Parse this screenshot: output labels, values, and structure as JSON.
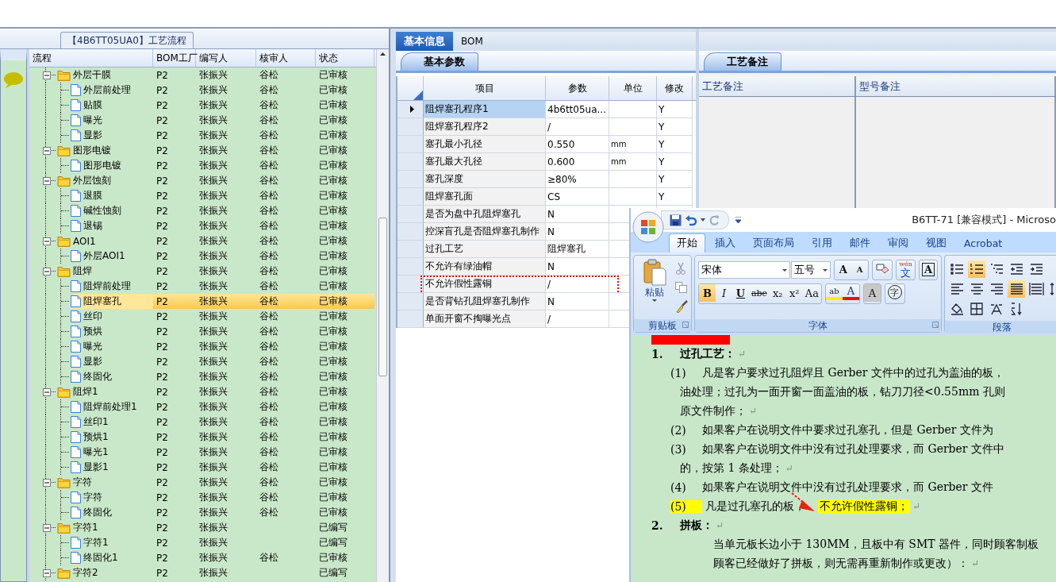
{
  "left_panel": {
    "title": "【4B6TT05UA0】工艺流程",
    "columns": [
      "流程",
      "BOM工厂",
      "编写人",
      "核审人",
      "状态"
    ],
    "tree": [
      {
        "name": "外层干膜",
        "bom": "P2",
        "writer": "张振兴",
        "reviewer": "谷松",
        "status": "已审核",
        "expanded": true,
        "selected": false,
        "children": [
          {
            "name": "外层前处理",
            "bom": "P2",
            "writer": "张振兴",
            "reviewer": "谷松",
            "status": "已审核",
            "selected": false
          },
          {
            "name": "贴膜",
            "bom": "P2",
            "writer": "张振兴",
            "reviewer": "谷松",
            "status": "已审核",
            "selected": false
          },
          {
            "name": "曝光",
            "bom": "P2",
            "writer": "张振兴",
            "reviewer": "谷松",
            "status": "已审核",
            "selected": false
          },
          {
            "name": "显影",
            "bom": "P2",
            "writer": "张振兴",
            "reviewer": "谷松",
            "status": "已审核",
            "selected": false
          }
        ]
      },
      {
        "name": "图形电镀",
        "bom": "P2",
        "writer": "张振兴",
        "reviewer": "谷松",
        "status": "已审核",
        "expanded": true,
        "selected": false,
        "children": [
          {
            "name": "图形电镀",
            "bom": "P2",
            "writer": "张振兴",
            "reviewer": "谷松",
            "status": "已审核",
            "selected": false
          }
        ]
      },
      {
        "name": "外层蚀刻",
        "bom": "P2",
        "writer": "张振兴",
        "reviewer": "谷松",
        "status": "已审核",
        "expanded": true,
        "selected": false,
        "children": [
          {
            "name": "退膜",
            "bom": "P2",
            "writer": "张振兴",
            "reviewer": "谷松",
            "status": "已审核",
            "selected": false
          },
          {
            "name": "碱性蚀刻",
            "bom": "P2",
            "writer": "张振兴",
            "reviewer": "谷松",
            "status": "已审核",
            "selected": false
          },
          {
            "name": "退锡",
            "bom": "P2",
            "writer": "张振兴",
            "reviewer": "谷松",
            "status": "已审核",
            "selected": false
          }
        ]
      },
      {
        "name": "AOI1",
        "bom": "P2",
        "writer": "张振兴",
        "reviewer": "谷松",
        "status": "已审核",
        "expanded": true,
        "selected": false,
        "children": [
          {
            "name": "外层AOI1",
            "bom": "P2",
            "writer": "张振兴",
            "reviewer": "谷松",
            "status": "已审核",
            "selected": false
          }
        ]
      },
      {
        "name": "阻焊",
        "bom": "P2",
        "writer": "张振兴",
        "reviewer": "谷松",
        "status": "已审核",
        "expanded": true,
        "selected": false,
        "children": [
          {
            "name": "阻焊前处理",
            "bom": "P2",
            "writer": "张振兴",
            "reviewer": "谷松",
            "status": "已审核",
            "selected": false
          },
          {
            "name": "阻焊塞孔",
            "bom": "P2",
            "writer": "张振兴",
            "reviewer": "谷松",
            "status": "已审核",
            "selected": true
          },
          {
            "name": "丝印",
            "bom": "P2",
            "writer": "张振兴",
            "reviewer": "谷松",
            "status": "已审核",
            "selected": false
          },
          {
            "name": "预烘",
            "bom": "P2",
            "writer": "张振兴",
            "reviewer": "谷松",
            "status": "已审核",
            "selected": false
          },
          {
            "name": "曝光",
            "bom": "P2",
            "writer": "张振兴",
            "reviewer": "谷松",
            "status": "已审核",
            "selected": false
          },
          {
            "name": "显影",
            "bom": "P2",
            "writer": "张振兴",
            "reviewer": "谷松",
            "status": "已审核",
            "selected": false
          },
          {
            "name": "终固化",
            "bom": "P2",
            "writer": "张振兴",
            "reviewer": "谷松",
            "status": "已审核",
            "selected": false
          }
        ]
      },
      {
        "name": "阻焊1",
        "bom": "P2",
        "writer": "张振兴",
        "reviewer": "谷松",
        "status": "已审核",
        "expanded": true,
        "selected": false,
        "children": [
          {
            "name": "阻焊前处理1",
            "bom": "P2",
            "writer": "张振兴",
            "reviewer": "谷松",
            "status": "已审核",
            "selected": false
          },
          {
            "name": "丝印1",
            "bom": "P2",
            "writer": "张振兴",
            "reviewer": "谷松",
            "status": "已审核",
            "selected": false
          },
          {
            "name": "预烘1",
            "bom": "P2",
            "writer": "张振兴",
            "reviewer": "谷松",
            "status": "已审核",
            "selected": false
          },
          {
            "name": "曝光1",
            "bom": "P2",
            "writer": "张振兴",
            "reviewer": "谷松",
            "status": "已审核",
            "selected": false
          },
          {
            "name": "显影1",
            "bom": "P2",
            "writer": "张振兴",
            "reviewer": "谷松",
            "status": "已审核",
            "selected": false
          }
        ]
      },
      {
        "name": "字符",
        "bom": "P2",
        "writer": "张振兴",
        "reviewer": "谷松",
        "status": "已审核",
        "expanded": true,
        "selected": false,
        "children": [
          {
            "name": "字符",
            "bom": "P2",
            "writer": "张振兴",
            "reviewer": "谷松",
            "status": "已审核",
            "selected": false
          },
          {
            "name": "终固化",
            "bom": "P2",
            "writer": "张振兴",
            "reviewer": "谷松",
            "status": "已审核",
            "selected": false
          }
        ]
      },
      {
        "name": "字符1",
        "bom": "P2",
        "writer": "张振兴",
        "status": "已编写",
        "expanded": true,
        "selected": false,
        "children": [
          {
            "name": "字符1",
            "bom": "P2",
            "writer": "张振兴",
            "status": "已编写",
            "selected": false
          },
          {
            "name": "终固化1",
            "bom": "P2",
            "writer": "张振兴",
            "reviewer": "谷松",
            "status": "已审核",
            "selected": false
          }
        ]
      },
      {
        "name": "字符2",
        "bom": "P2",
        "writer": "张振兴",
        "status": "已编写",
        "expanded": true,
        "selected": false
      }
    ]
  },
  "middle_panel": {
    "tabs": [
      {
        "label": "基本信息",
        "selected": true
      },
      {
        "label": "BOM",
        "selected": false
      }
    ],
    "subtab": "基本参数",
    "columns": [
      "项目",
      "参数",
      "单位",
      "修改"
    ],
    "rows": [
      {
        "item": "阻焊塞孔程序1",
        "value": "4b6tt05ua...",
        "modify": "Y",
        "selected": true,
        "highlighted": false
      },
      {
        "item": "阻焊塞孔程序2",
        "value": "/",
        "modify": "Y",
        "selected": false,
        "highlighted": false
      },
      {
        "item": "塞孔最小孔径",
        "value": "0.550",
        "unit": "mm",
        "modify": "Y",
        "selected": false,
        "highlighted": false
      },
      {
        "item": "塞孔最大孔径",
        "value": "0.600",
        "unit": "mm",
        "modify": "Y",
        "selected": false,
        "highlighted": false
      },
      {
        "item": "塞孔深度",
        "value": "≥80%",
        "modify": "Y",
        "selected": false,
        "highlighted": false
      },
      {
        "item": "阻焊塞孔面",
        "value": "CS",
        "modify": "Y",
        "selected": false,
        "highlighted": false
      },
      {
        "item": "是否为盘中孔阻焊塞孔",
        "value": "N",
        "selected": false,
        "highlighted": false
      },
      {
        "item": "控深盲孔是否阻焊塞孔制作",
        "value": "N",
        "selected": false,
        "highlighted": false
      },
      {
        "item": "过孔工艺",
        "value": "阻焊塞孔",
        "selected": false,
        "highlighted": false
      },
      {
        "item": "不允许有绿油帽",
        "value": "N",
        "selected": false,
        "highlighted": false
      },
      {
        "item": "不允许假性露铜",
        "value": "/",
        "selected": false,
        "highlighted": true
      },
      {
        "item": "是否背钻孔阻焊塞孔制作",
        "value": "N",
        "selected": false,
        "highlighted": false
      },
      {
        "item": "单面开窗不掏曝光点",
        "value": "/",
        "selected": false,
        "highlighted": false
      }
    ]
  },
  "right_panel": {
    "subtab": "工艺备注",
    "columns": [
      "工艺备注",
      "型号备注"
    ]
  },
  "word_window": {
    "title": "B6TT-71 [兼容模式] - Microso",
    "tabs": [
      {
        "label": "开始",
        "selected": true
      },
      {
        "label": "插入",
        "selected": false
      },
      {
        "label": "页面布局",
        "selected": false
      },
      {
        "label": "引用",
        "selected": false
      },
      {
        "label": "邮件",
        "selected": false
      },
      {
        "label": "审阅",
        "selected": false
      },
      {
        "label": "视图",
        "selected": false
      },
      {
        "label": "Acrobat",
        "selected": false
      }
    ],
    "clipboard": {
      "paste_label": "粘贴",
      "group_label": "剪贴板"
    },
    "font": {
      "name": "宋体",
      "size": "五号",
      "group_label": "字体",
      "row1_tools": [
        {
          "kind": "grow-font",
          "label": "A"
        },
        {
          "kind": "shrink-font",
          "label": "A"
        },
        {
          "kind": "clear-format"
        },
        {
          "kind": "phonetic",
          "label": "文",
          "sub": "wén"
        },
        {
          "kind": "char-border",
          "label": "A"
        }
      ],
      "format_buttons": [
        {
          "kind": "bold",
          "label": "B",
          "active": true
        },
        {
          "kind": "italic",
          "label": "I",
          "active": false
        },
        {
          "kind": "underline",
          "label": "U",
          "active": false
        },
        {
          "kind": "strikethrough",
          "label": "abc",
          "active": false
        },
        {
          "kind": "subscript",
          "label": "x₂",
          "active": false
        },
        {
          "kind": "superscript",
          "label": "x²",
          "active": false
        },
        {
          "kind": "change-case",
          "label": "Aa",
          "active": false
        }
      ],
      "row2_tools": [
        {
          "kind": "highlight",
          "label": "ab"
        },
        {
          "kind": "font-color",
          "label": "A"
        },
        {
          "kind": "char-shading",
          "label": "A"
        },
        {
          "kind": "enclosed",
          "label": "字"
        }
      ]
    },
    "paragraph": {
      "group_label": "段落",
      "rows": [
        [
          {
            "kind": "bullets",
            "active": false
          },
          {
            "kind": "numbering",
            "active": true
          },
          {
            "kind": "multilevel",
            "active": false
          },
          {
            "kind": "decrease-indent",
            "active": false
          },
          {
            "kind": "increase-indent",
            "active": false
          }
        ],
        [
          {
            "kind": "align-left",
            "active": false
          },
          {
            "kind": "align-center",
            "active": false
          },
          {
            "kind": "align-right",
            "active": false
          },
          {
            "kind": "justify",
            "active": true
          },
          {
            "kind": "distribute",
            "active": false
          },
          {
            "kind": "line-spacing",
            "active": false
          }
        ],
        [
          {
            "kind": "shading",
            "active": false
          },
          {
            "kind": "borders",
            "active": false
          },
          {
            "kind": "asian-layout",
            "active": false
          },
          {
            "kind": "sort",
            "active": false
          }
        ]
      ]
    },
    "document": [
      {
        "kind": "heading",
        "number": "1.",
        "text": "过孔工艺：",
        "mark": "↵"
      },
      {
        "kind": "item",
        "number": "(1)",
        "number_highlighted": false,
        "text": "凡是客户要求过孔阻焊且 Gerber 文件中的过孔为盖油的板，"
      },
      {
        "kind": "cont",
        "text": "油处理；过孔为一面开窗一面盖油的板，钻刀刀径<0.55mm 孔则"
      },
      {
        "kind": "cont",
        "text": "原文件制作；",
        "mark": "↵"
      },
      {
        "kind": "item",
        "number": "(2)",
        "number_highlighted": false,
        "text": "如果客户在说明文件中要求过孔塞孔，但是 Gerber 文件为"
      },
      {
        "kind": "item",
        "number": "(3)",
        "number_highlighted": false,
        "text": "如果客户在说明文件中没有过孔处理要求，而 Gerber 文件中"
      },
      {
        "kind": "cont",
        "text": "的，按第 1 条处理；",
        "mark": "↵"
      },
      {
        "kind": "item",
        "number": "(4)",
        "number_highlighted": false,
        "text": "如果客户在说明文件中没有过孔处理要求，而 Gerber 文件"
      },
      {
        "kind": "item",
        "number": "(5)",
        "number_highlighted": true,
        "text": "凡是过孔塞孔的板，",
        "highlight": "不允许假性露铜；",
        "mark": "↵"
      },
      {
        "kind": "heading",
        "number": "2.",
        "text": "拼板：",
        "mark": "↵"
      },
      {
        "kind": "body",
        "text": "当单元板长边小于 130MM，且板中有 SMT 器件，同时顾客制板"
      },
      {
        "kind": "body",
        "text": "顾客已经做好了拼板，则无需再重新制作或更改）：",
        "mark": "↵"
      }
    ]
  }
}
